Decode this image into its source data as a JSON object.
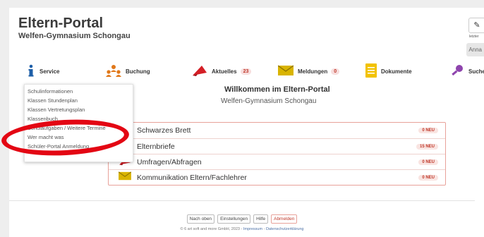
{
  "header": {
    "app_title": "Eltern-Portal",
    "school_name": "Welfen-Gymnasium Schongau",
    "top_right_label": "letzter",
    "lang_button": "Anna"
  },
  "nav": [
    {
      "label": "Service",
      "icon": "info-icon"
    },
    {
      "label": "Buchung",
      "icon": "people-icon"
    },
    {
      "label": "Aktuelles",
      "icon": "megaphone-icon",
      "badge": "23"
    },
    {
      "label": "Meldungen",
      "icon": "envelope-icon",
      "badge": "0"
    },
    {
      "label": "Dokumente",
      "icon": "document-icon"
    },
    {
      "label": "Suche",
      "icon": "search-icon"
    }
  ],
  "dropdown": [
    "Schulinformationen",
    "Klassen Stundenplan",
    "Klassen Vertretungsplan",
    "Klassenbuch",
    "Schulaufgaben / Weitere Termine",
    "Wer macht was",
    "Schüler-Portal Anmeldung"
  ],
  "welcome": {
    "title": "Willkommen im Eltern-Portal",
    "subtitle": "Welfen-Gymnasium Schongau"
  },
  "rows": [
    {
      "label": "Schwarzes Brett",
      "badge": "0 NEU",
      "icon": "board-icon"
    },
    {
      "label": "Elternbriefe",
      "badge": "15 NEU",
      "icon": "letter-icon"
    },
    {
      "label": "Umfragen/Abfragen",
      "badge": "0 NEU",
      "icon": "megaphone-icon"
    },
    {
      "label": "Kommunikation Eltern/Fachlehrer",
      "badge": "0 NEU",
      "icon": "envelope-icon"
    }
  ],
  "footer": {
    "buttons": [
      "Nach oben",
      "Einstellungen",
      "Hilfe",
      "Abmelden"
    ],
    "copyright": "© 6 art soft and more GmbH, 2023 - ",
    "impressum": "Impressum",
    "separator": " - ",
    "privacy": "Datenschutzerklärung"
  },
  "colors": {
    "accent_red": "#c0392b",
    "highlight_red": "#e30613",
    "info_blue": "#1e5fa8",
    "envelope_yellow": "#d9b400",
    "people_orange": "#e0781a"
  }
}
